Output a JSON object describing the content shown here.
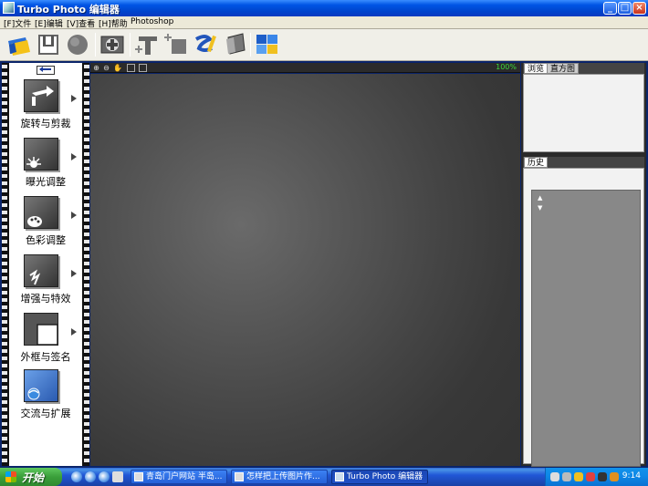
{
  "window": {
    "title": "Turbo Photo 编辑器",
    "controls": {
      "minimize": "_",
      "maximize": "□",
      "close": "×"
    }
  },
  "menu": {
    "items": [
      "[F]文件",
      "[E]编辑",
      "[V]查看",
      "[H]帮助",
      "Photoshop"
    ]
  },
  "toolbar": {
    "icons": [
      "open-icon",
      "save-icon",
      "sphere-icon",
      "view-icon",
      "text-icon",
      "add-frame-icon",
      "brush-icon",
      "stamp-icon",
      "mosaic-icon"
    ]
  },
  "left_dock": {
    "items": [
      {
        "label": "旋转与剪裁",
        "icon": "rotate-crop-icon",
        "has_arrow": true
      },
      {
        "label": "曝光调整",
        "icon": "exposure-icon",
        "has_arrow": true
      },
      {
        "label": "色彩调整",
        "icon": "color-adjust-icon",
        "has_arrow": true
      },
      {
        "label": "增强与特效",
        "icon": "enhance-effects-icon",
        "has_arrow": true
      },
      {
        "label": "外框与签名",
        "icon": "frame-signature-icon",
        "has_arrow": true
      },
      {
        "label": "交流与扩展",
        "icon": "share-extend-icon",
        "has_arrow": false
      }
    ]
  },
  "canvas": {
    "zoom": "100%",
    "tools": [
      "zoom-in-icon",
      "zoom-out-icon",
      "hand-icon",
      "fit-icon",
      "actual-size-icon"
    ]
  },
  "right_panel": {
    "tabs_top": [
      "浏览",
      "直方图"
    ],
    "tabs_bottom": [
      "历史"
    ]
  },
  "taskbar": {
    "start_label": "开始",
    "tasks": [
      {
        "label": "青岛门户网站 半岛...",
        "active": false
      },
      {
        "label": "怎样把上传图片作...",
        "active": false
      },
      {
        "label": "Turbo Photo 编辑器",
        "active": true
      }
    ],
    "clock": "9:14"
  }
}
